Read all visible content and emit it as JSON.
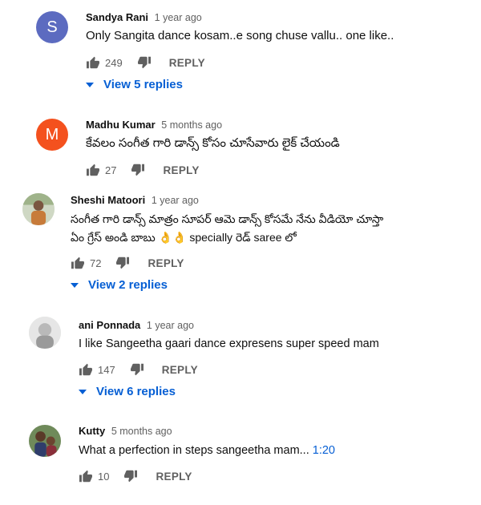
{
  "comments": [
    {
      "author": "Sandya Rani",
      "time": "1 year ago",
      "avatar_letter": "S",
      "avatar_color": "#5c6bc0",
      "text": "Only Sangita dance kosam..e song chuse vallu.. one like..",
      "likes": "249",
      "reply_label": "REPLY",
      "view_replies": "View 5 replies"
    },
    {
      "author": "Madhu Kumar",
      "time": "5 months ago",
      "avatar_letter": "M",
      "avatar_color": "#f4511e",
      "text": "కేవలం సంగీత గారి డాన్స్ కోసం చూసేవారు లైక్ చేయండి",
      "likes": "27",
      "reply_label": "REPLY"
    },
    {
      "author": "Sheshi Matoori",
      "time": "1 year ago",
      "text_line1": "సంగీత గారి డాన్స్ మాత్రం సూపర్ ఆమె డాన్స్ కోసమే నేను వీడియో చూస్తా",
      "text_line2": "ఏం గ్రేస్ అండి బాబు 👌👌 specially రెడ్ saree లో",
      "likes": "72",
      "reply_label": "REPLY",
      "view_replies": "View 2 replies"
    },
    {
      "author": "ani Ponnada",
      "time": "1 year ago",
      "text": "I like Sangeetha gaari dance expresens super speed mam",
      "likes": "147",
      "reply_label": "REPLY",
      "view_replies": "View 6 replies"
    },
    {
      "author": "Kutty",
      "time": "5 months ago",
      "text": "What a perfection in steps sangeetha mam... ",
      "timestamp_link": "1:20",
      "likes": "10",
      "reply_label": "REPLY"
    }
  ],
  "colors": {
    "link": "#065fd4",
    "secondary": "#606060"
  },
  "icons": {
    "like": "thumb-up-icon",
    "dislike": "thumb-down-icon",
    "expand": "caret-down-icon"
  }
}
